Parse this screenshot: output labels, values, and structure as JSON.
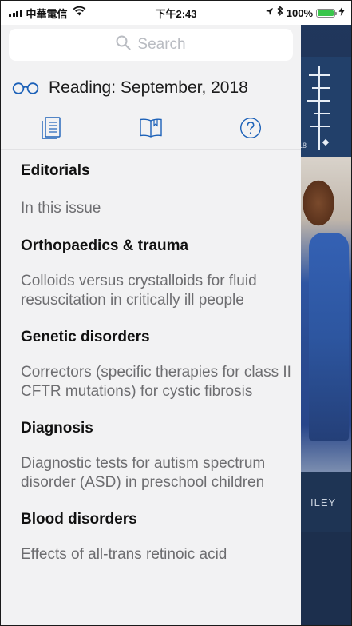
{
  "status_bar": {
    "carrier": "中華電信",
    "time": "下午2:43",
    "battery_percent": "100%",
    "battery_level": 1.0,
    "colors": {
      "battery": "#39c64b"
    }
  },
  "search": {
    "placeholder": "Search"
  },
  "reading": {
    "label": "Reading: September, 2018"
  },
  "tabs": [
    {
      "icon": "table-of-contents-icon"
    },
    {
      "icon": "book-icon"
    },
    {
      "icon": "help-icon"
    }
  ],
  "sections": [
    {
      "heading": "Editorials",
      "articles": [
        "In this issue"
      ]
    },
    {
      "heading": "Orthopaedics & trauma",
      "articles": [
        "Colloids versus crystalloids for fluid resuscitation in critically ill people"
      ]
    },
    {
      "heading": "Genetic disorders",
      "articles": [
        "Correctors (specific therapies for class II CFTR mutations) for cystic fibrosis"
      ]
    },
    {
      "heading": "Diagnosis",
      "articles": [
        "Diagnostic tests for autism spectrum disorder (ASD) in preschool children"
      ]
    },
    {
      "heading": "Blood disorders",
      "articles": [
        "Effects of all-trans retinoic acid"
      ]
    }
  ],
  "background": {
    "year_fragment": "18",
    "brand_fragment": "ILEY",
    "colors": {
      "navy": "#1e3454",
      "accent": "#1c61b8"
    }
  }
}
